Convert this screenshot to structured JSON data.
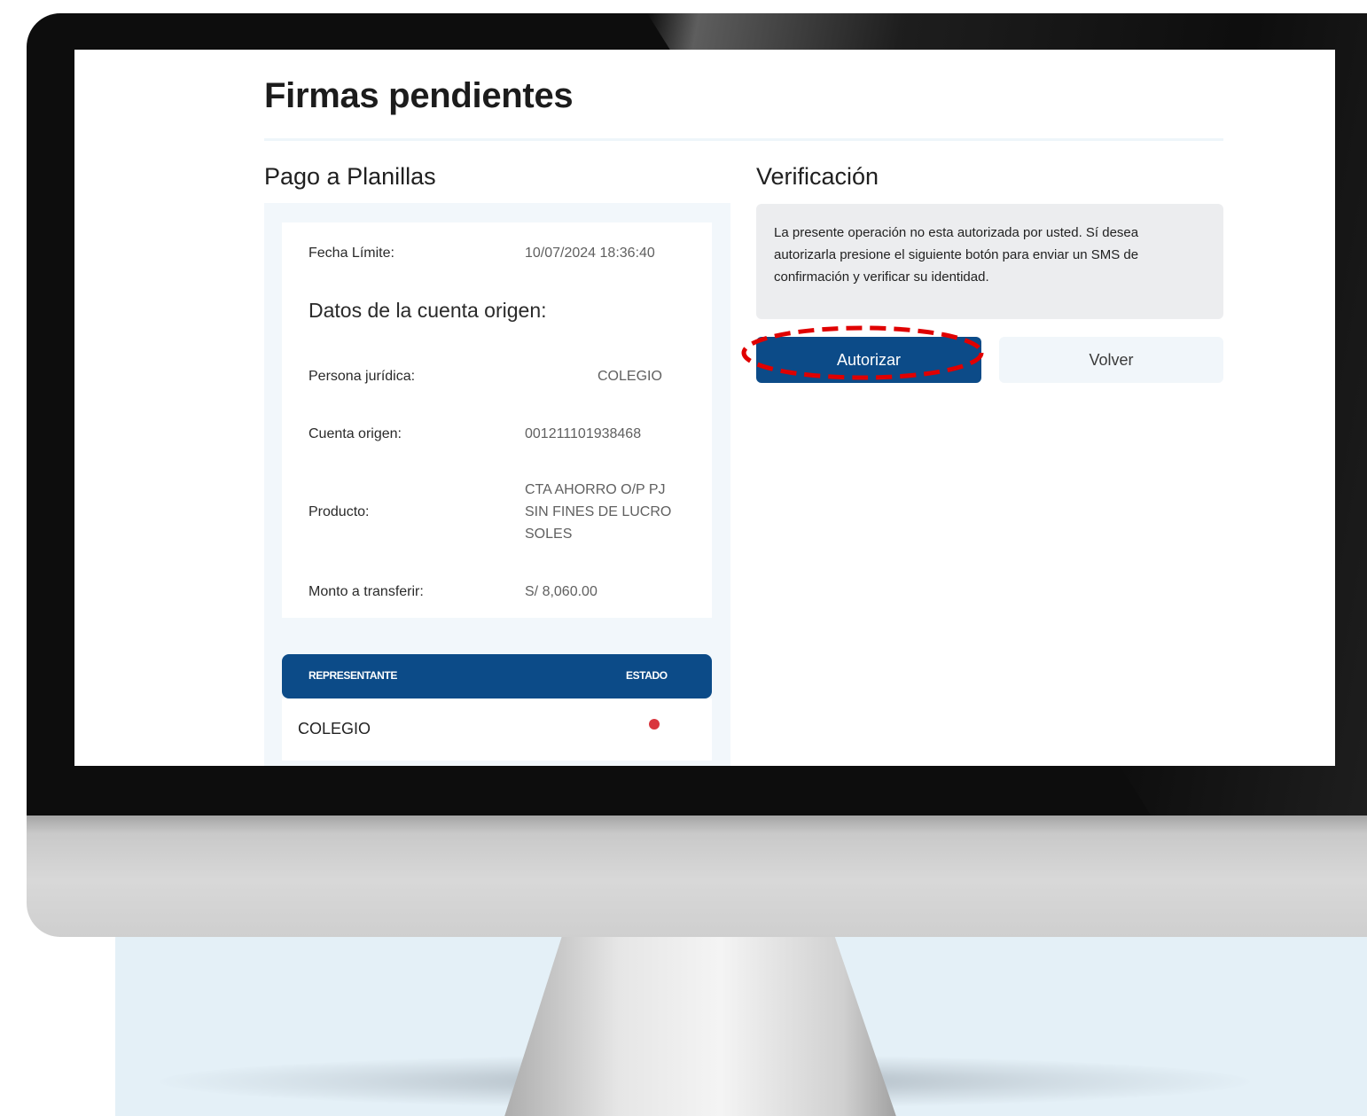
{
  "page": {
    "title": "Firmas pendientes"
  },
  "left": {
    "section_title": "Pago a Planillas",
    "deadline": {
      "label": "Fecha Límite:",
      "value": "10/07/2024 18:36:40"
    },
    "origin_title": "Datos de la cuenta origen:",
    "rows": [
      {
        "label": "Persona jurídica:",
        "value": "COLEGIO"
      },
      {
        "label": "Cuenta origen:",
        "value": "001211101938468"
      },
      {
        "label": "Producto:",
        "value_lines": [
          "CTA AHORRO O/P PJ",
          "SIN FINES DE LUCRO",
          "SOLES"
        ]
      },
      {
        "label": "Monto a transferir:",
        "value": "S/ 8,060.00"
      }
    ],
    "table": {
      "headers": [
        "REPRESENTANTE",
        "ESTADO"
      ],
      "rows": [
        {
          "name": "COLEGIO",
          "status": "pending",
          "status_color": "#d9363e"
        }
      ]
    }
  },
  "right": {
    "section_title": "Verificación",
    "message_lines": [
      "La presente operación no esta autorizada por usted. Sí desea",
      "autorizarla presione el siguiente botón para enviar un SMS de",
      "confirmación y verificar su identidad."
    ],
    "buttons": {
      "authorize": "Autorizar",
      "back": "Volver"
    }
  },
  "colors": {
    "primary": "#0c4b88",
    "highlight": "#e00000",
    "status_pending": "#d9363e"
  }
}
